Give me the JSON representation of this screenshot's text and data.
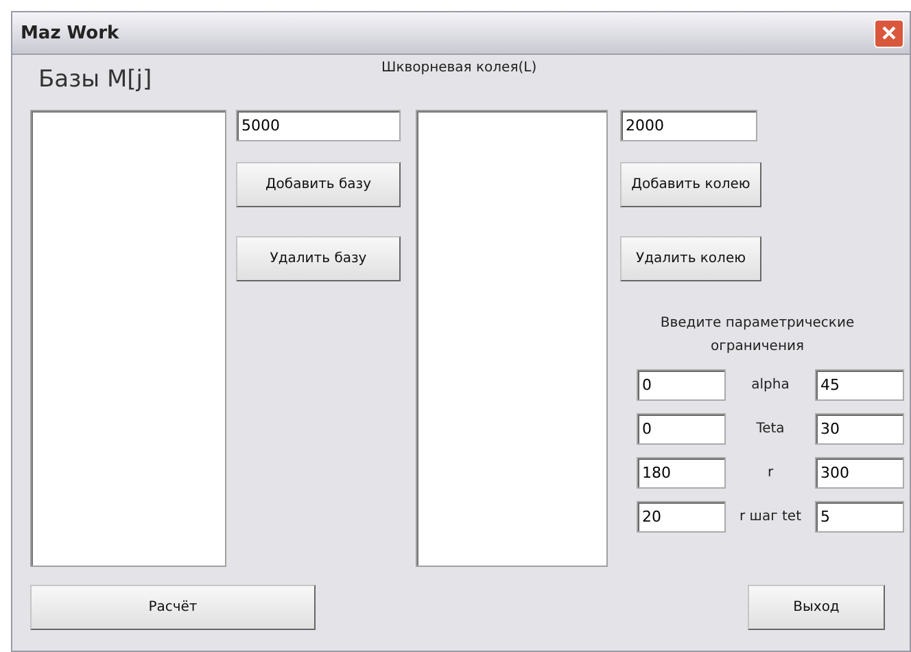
{
  "window": {
    "title": "Maz Work"
  },
  "bases": {
    "label": "Базы M[j]",
    "value": "5000",
    "add_button": "Добавить базу",
    "remove_button": "Удалить базу"
  },
  "track": {
    "label": "Шкворневая колея(L)",
    "value": "2000",
    "add_button": "Добавить колею",
    "remove_button": "Удалить колею"
  },
  "constraints": {
    "label": "Введите параметрические ограничения",
    "rows": [
      {
        "min": "0",
        "name": "alpha",
        "max": "45"
      },
      {
        "min": "0",
        "name": "Teta",
        "max": "30"
      },
      {
        "min": "180",
        "name": "r",
        "max": "300"
      },
      {
        "min": "20",
        "name": "r шаг tet",
        "max": "5"
      }
    ]
  },
  "buttons": {
    "calculate": "Расчёт",
    "exit": "Выход"
  }
}
